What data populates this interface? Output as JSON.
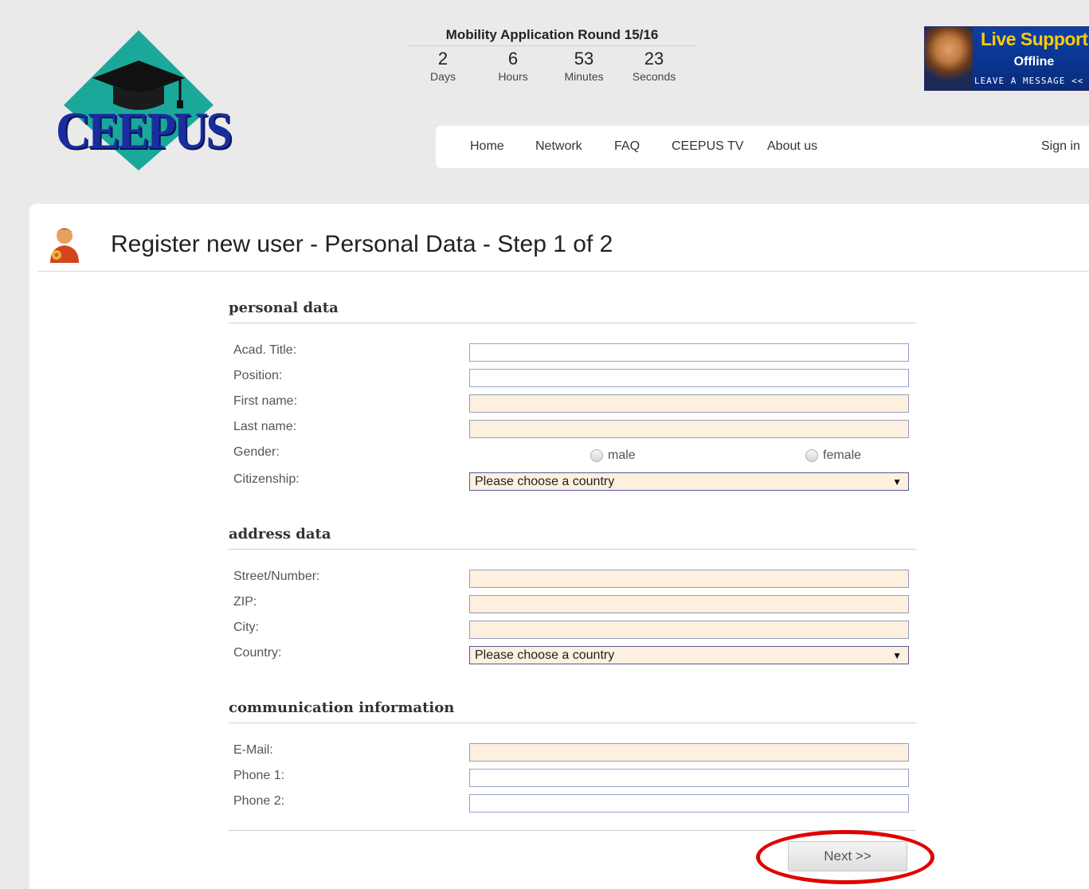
{
  "header": {
    "logo_text": "CEEPUS",
    "countdown": {
      "title": "Mobility Application Round 15/16",
      "units": [
        {
          "value": "2",
          "label": "Days"
        },
        {
          "value": "6",
          "label": "Hours"
        },
        {
          "value": "53",
          "label": "Minutes"
        },
        {
          "value": "23",
          "label": "Seconds"
        }
      ]
    },
    "live_support": {
      "title": "Live Support!",
      "status": "Offline",
      "message": "LEAVE A MESSAGE <<"
    }
  },
  "nav": {
    "items": [
      "Home",
      "Network",
      "FAQ",
      "CEEPUS TV",
      "About us"
    ],
    "sign_in": "Sign in"
  },
  "page": {
    "title": "Register new user - Personal Data - Step 1 of 2",
    "icon": "user-icon"
  },
  "personal": {
    "section_title": "personal data",
    "acad_title_label": "Acad. Title:",
    "position_label": "Position:",
    "first_name_label": "First name:",
    "last_name_label": "Last name:",
    "gender_label": "Gender:",
    "gender_options": [
      "male",
      "female"
    ],
    "citizenship_label": "Citizenship:",
    "citizenship_value": "Please choose a country"
  },
  "address": {
    "section_title": "address data",
    "street_label": "Street/Number:",
    "zip_label": "ZIP:",
    "city_label": "City:",
    "country_label": "Country:",
    "country_value": "Please choose a country"
  },
  "communication": {
    "section_title": "communication information",
    "email_label": "E-Mail:",
    "phone1_label": "Phone 1:",
    "phone2_label": "Phone 2:"
  },
  "actions": {
    "next_label": "Next >>"
  },
  "colors": {
    "required_field_bg": "#fdf0de",
    "highlight": "#e00000",
    "brand_blue": "#1a2d9e",
    "logo_teal": "#1aa89a"
  }
}
